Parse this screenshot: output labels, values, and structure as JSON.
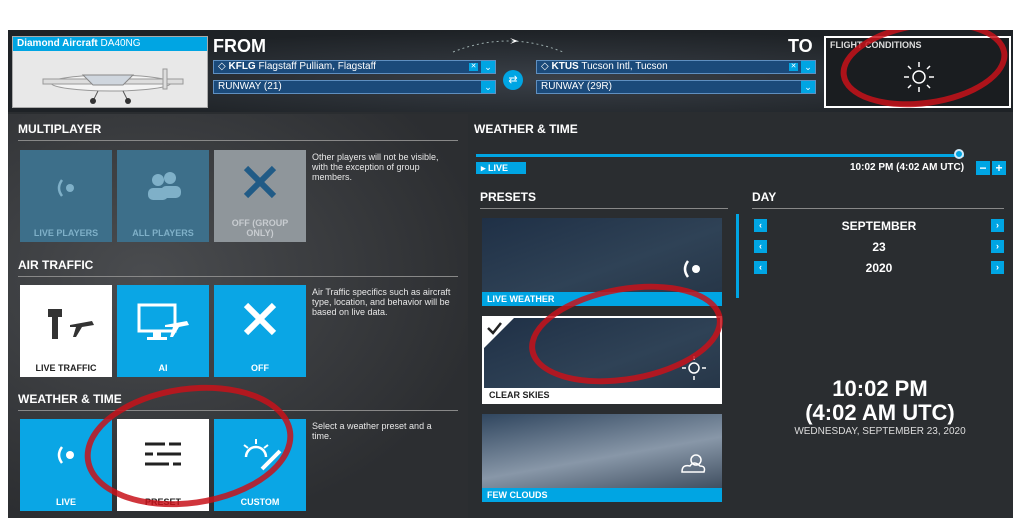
{
  "aircraft": {
    "maker": "Diamond Aircraft",
    "model": "DA40NG"
  },
  "route": {
    "from_label": "FROM",
    "to_label": "TO",
    "from_airport": {
      "code": "KFLG",
      "name": "Flagstaff Pulliam, Flagstaff",
      "runway": "RUNWAY (21)"
    },
    "to_airport": {
      "code": "KTUS",
      "name": "Tucson Intl, Tucson",
      "runway": "RUNWAY (29R)"
    }
  },
  "flight_conditions": {
    "title": "FLIGHT CONDITIONS",
    "icon": "sun-icon"
  },
  "multiplayer": {
    "title": "MULTIPLAYER",
    "options": [
      {
        "label": "LIVE PLAYERS",
        "icon": "broadcast-icon"
      },
      {
        "label": "ALL PLAYERS",
        "icon": "users-icon"
      },
      {
        "label": "OFF (GROUP ONLY)",
        "icon": "x-icon"
      }
    ],
    "description": "Other players will not be visible, with the exception of group members."
  },
  "air_traffic": {
    "title": "AIR TRAFFIC",
    "options": [
      {
        "label": "LIVE TRAFFIC",
        "icon": "tower-plane-icon"
      },
      {
        "label": "AI",
        "icon": "monitor-plane-icon"
      },
      {
        "label": "OFF",
        "icon": "x-icon"
      }
    ],
    "description": "Air Traffic specifics such as aircraft type, location, and behavior will be based on live data."
  },
  "weather_time_left": {
    "title": "WEATHER & TIME",
    "options": [
      {
        "label": "LIVE",
        "icon": "broadcast-icon"
      },
      {
        "label": "PRESET",
        "icon": "sliders-icon"
      },
      {
        "label": "CUSTOM",
        "icon": "sun-edit-icon"
      }
    ],
    "description": "Select a weather preset and a time."
  },
  "weather_time": {
    "title": "WEATHER & TIME",
    "live_label": "LIVE",
    "time_readout": "10:02 PM (4:02 AM UTC)",
    "minus": "−",
    "plus": "+",
    "slider_fraction": 0.99
  },
  "presets": {
    "title": "PRESETS",
    "items": [
      "LIVE WEATHER",
      "CLEAR SKIES",
      "FEW CLOUDS"
    ]
  },
  "day": {
    "title": "DAY",
    "month": "SEPTEMBER",
    "date": "23",
    "year": "2020",
    "clock_local": "10:02 PM",
    "clock_utc": "(4:02 AM UTC)",
    "full_date": "WEDNESDAY, SEPTEMBER 23, 2020"
  },
  "colors": {
    "accent": "#00a5e3",
    "annotation": "#c8121a"
  }
}
